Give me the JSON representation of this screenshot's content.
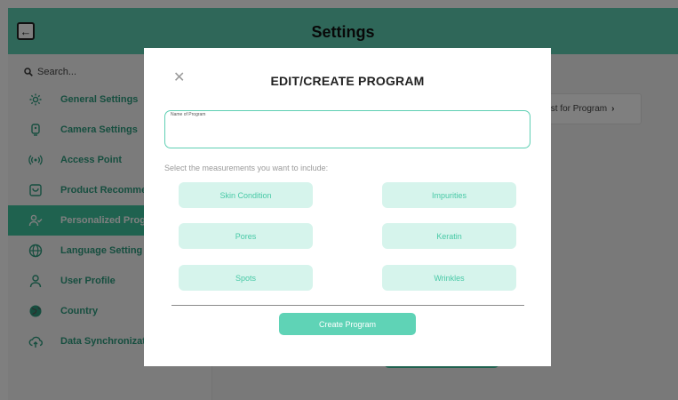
{
  "header": {
    "title": "Settings"
  },
  "sidebar": {
    "search_placeholder": "Search...",
    "items": [
      {
        "label": "General Settings",
        "icon": "gear-icon",
        "active": false
      },
      {
        "label": "Camera Settings",
        "icon": "camera-icon",
        "active": false
      },
      {
        "label": "Access Point",
        "icon": "wifi-icon",
        "active": false
      },
      {
        "label": "Product Recommer",
        "icon": "cart-icon",
        "active": false
      },
      {
        "label": "Personalized Progr",
        "icon": "user-check-icon",
        "active": true
      },
      {
        "label": "Language Setting",
        "icon": "globe-icon",
        "active": false
      },
      {
        "label": "User Profile",
        "icon": "user-icon",
        "active": false
      },
      {
        "label": "Country",
        "icon": "earth-icon",
        "active": false
      },
      {
        "label": "Data Synchronizati",
        "icon": "cloud-upload-icon",
        "active": false
      }
    ]
  },
  "main": {
    "chip_label": "List for Program"
  },
  "modal": {
    "title": "EDIT/CREATE PROGRAM",
    "close_glyph": "✕",
    "name_label": "Name of Program",
    "name_value": "",
    "measure_label": "Select the measurements you want to include:",
    "measurements": [
      "Skin Condition",
      "Impurities",
      "Pores",
      "Keratin",
      "Spots",
      "Wrinkles"
    ],
    "create_label": "Create Program"
  },
  "colors": {
    "accent": "#3fc49f",
    "header_bg": "#5fcfb3",
    "pill_bg": "#d6f4ec",
    "pill_text": "#48c9a6"
  }
}
